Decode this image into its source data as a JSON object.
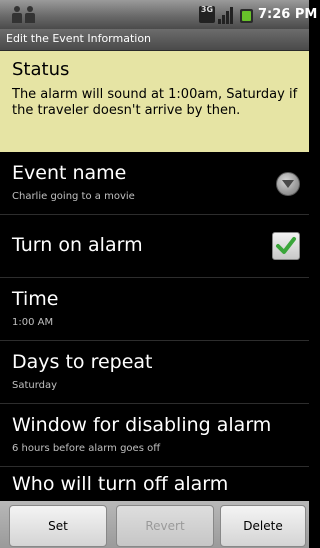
{
  "status_bar": {
    "network_badge": "3G",
    "time": "7:26 PM",
    "icons": [
      "usb-debug-icon",
      "3g-icon",
      "signal-icon",
      "battery-charging-icon"
    ]
  },
  "title_bar": {
    "title": "Edit the Event Information"
  },
  "status_panel": {
    "title": "Status",
    "message": "The alarm will sound at 1:00am, Saturday if the traveler doesn't arrive by then."
  },
  "rows": {
    "event_name": {
      "title": "Event name",
      "value": "Charlie going to a movie"
    },
    "turn_on_alarm": {
      "title": "Turn on alarm",
      "checked": true
    },
    "time": {
      "title": "Time",
      "value": "1:00 AM"
    },
    "days_to_repeat": {
      "title": "Days to repeat",
      "value": "Saturday"
    },
    "window": {
      "title": "Window for disabling alarm",
      "value": "6 hours before alarm goes off"
    },
    "who": {
      "title": "Who will turn off alarm"
    }
  },
  "buttons": {
    "set": "Set",
    "revert": "Revert",
    "delete": "Delete"
  },
  "colors": {
    "status_panel_bg": "#e6e4a4",
    "check_green": "#3aa63a",
    "battery_green": "#68c22a"
  }
}
